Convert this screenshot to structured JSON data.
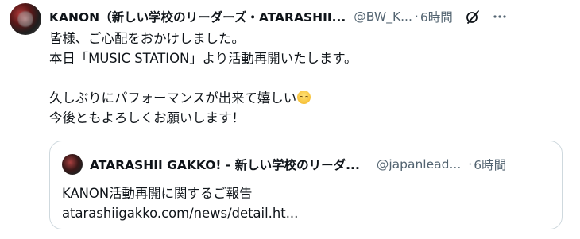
{
  "tweet": {
    "author_name": "KANON（新しい学校のリーダーズ・ATARASHII...",
    "handle": "@BW_K...",
    "separator": "·",
    "time": "6時間",
    "body": "皆様、ご心配をおかけしました。\n本日「MUSIC STATION」より活動再開いたします。\n\n久しぶりにパフォーマンスが出来て嬉しい",
    "body_after_emoji": "\n今後ともよろしくお願いします！",
    "emoji_icon": "relieved-face-emoji",
    "grok_icon": "grok-icon",
    "more_icon": "more-icon"
  },
  "quoted": {
    "author_name": "ATARASHII GAKKO! - 新しい学校のリーダ...",
    "handle": "@japanlead...",
    "separator": "·",
    "time": "6時間",
    "title": "KANON活動再開に関するご報告",
    "link": "atarashiigakko.com/news/detail.ht..."
  },
  "colors": {
    "text": "#0f1419",
    "secondary": "#536471",
    "border": "#cfd9de"
  }
}
